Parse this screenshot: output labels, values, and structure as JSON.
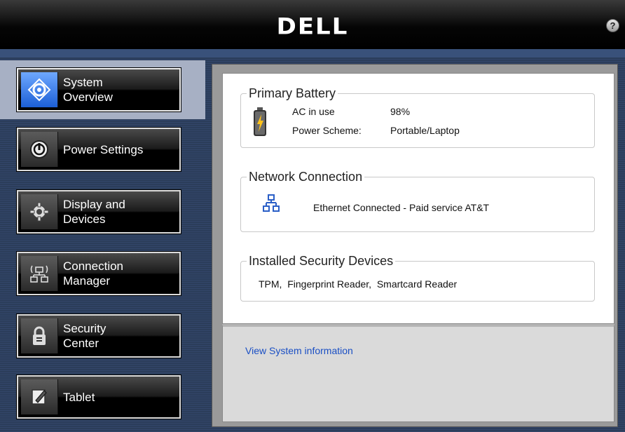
{
  "header": {
    "logo_text": "DELL",
    "help_label": "?"
  },
  "nav": [
    {
      "label_line1": "System",
      "label_line2": "Overview",
      "icon": "system-overview-icon",
      "active": true
    },
    {
      "label_line1": "Power Settings",
      "label_line2": "",
      "icon": "power-icon",
      "active": false
    },
    {
      "label_line1": "Display and",
      "label_line2": "Devices",
      "icon": "gear-icon",
      "active": false
    },
    {
      "label_line1": "Connection",
      "label_line2": "Manager",
      "icon": "network-icon",
      "active": false
    },
    {
      "label_line1": "Security",
      "label_line2": "Center",
      "icon": "lock-icon",
      "active": false
    },
    {
      "label_line1": "Tablet",
      "label_line2": "",
      "icon": "tablet-pen-icon",
      "active": false
    }
  ],
  "battery": {
    "title": "Primary Battery",
    "status": "AC in use",
    "percent": "98%",
    "scheme_label": "Power Scheme:",
    "scheme_value": "Portable/Laptop"
  },
  "network": {
    "title": "Network Connection",
    "status": "Ethernet Connected - Paid service AT&T"
  },
  "security": {
    "title": "Installed Security Devices",
    "devices": "TPM,  Fingerprint Reader,  Smartcard Reader"
  },
  "footer": {
    "link": "View System information"
  },
  "colors": {
    "accent_blue": "#1a4fc4",
    "nav_background": "#2d3f5c"
  }
}
